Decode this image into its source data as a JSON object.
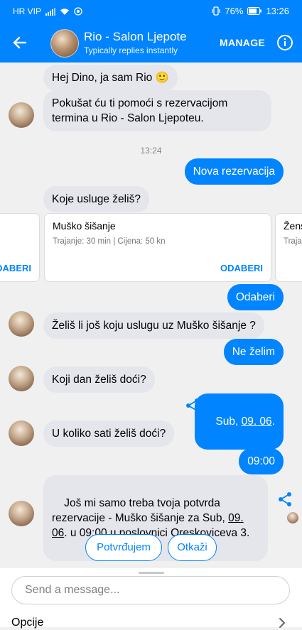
{
  "status_bar": {
    "carrier": "HR VIP",
    "battery": "76%",
    "time": "13:26"
  },
  "header": {
    "title": "Rio - Salon Ljepote",
    "subtitle": "Typically replies instantly",
    "manage_label": "MANAGE"
  },
  "messages": {
    "m1": "Hej Dino, ja sam Rio 🙂",
    "m2": "Pokušat ću ti pomoći s rezervacijom\ntermina u Rio - Salon Ljepoteu.",
    "timestamp": "13:24",
    "m3": "Nova rezervacija",
    "m4": "Koje usluge želiš?",
    "m5": "Odaberi",
    "m6": "Želiš li još koju uslugu uz Muško šišanje ?",
    "m7": "Ne želim",
    "m8": "Koji dan želiš doći?",
    "m9_prefix": "Sub, ",
    "m9_date": "09. 06",
    "m9_suffix": ".",
    "m10": "U koliko sati želiš doći?",
    "m11": "09:00",
    "m12_a": "Još mi samo treba tvoja potvrda\nrezervacije - Muško šišanje za Sub, ",
    "m12_date1": "09.",
    "m12_b": "\n",
    "m12_date2": "06",
    "m12_c": ". u 09:00 u poslovnici Oreskoviceva 3."
  },
  "carousel": {
    "left_card_button": "ODABERI",
    "main_card": {
      "title": "Muško šišanje",
      "desc": "Trajanje: 30 min | Cijena: 50 kn",
      "button": "ODABERI"
    },
    "right_card": {
      "title": "Žens",
      "desc": "Traja"
    }
  },
  "quick_replies": {
    "confirm": "Potvrđujem",
    "cancel": "Otkaži"
  },
  "composer": {
    "placeholder": "Send a message...",
    "options_label": "Opcije"
  },
  "colors": {
    "brand": "#0084ff",
    "incoming_bubble": "#e4e6eb",
    "background": "#f1f0f0"
  }
}
